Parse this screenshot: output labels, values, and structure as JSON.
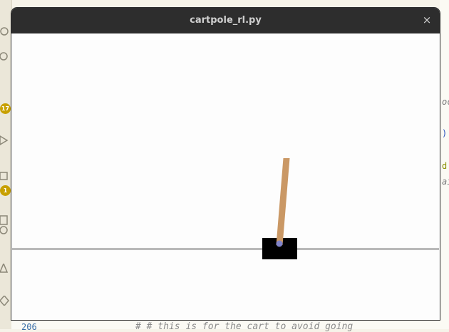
{
  "window": {
    "title": "cartpole_rl.py",
    "close_glyph": "×"
  },
  "background_ide": {
    "badges": [
      "17",
      "1"
    ],
    "right_fragments": [
      "oc",
      ")",
      "d",
      "ai"
    ],
    "line_number": "206",
    "code_fragment": "#    # this is for the cart to avoid going"
  },
  "simulation": {
    "pole_angle_deg": 8,
    "colors": {
      "cart": "#000000",
      "pole": "#ca9865",
      "axle": "#8184cb",
      "track": "#000000",
      "background": "#fdfdfd"
    }
  }
}
